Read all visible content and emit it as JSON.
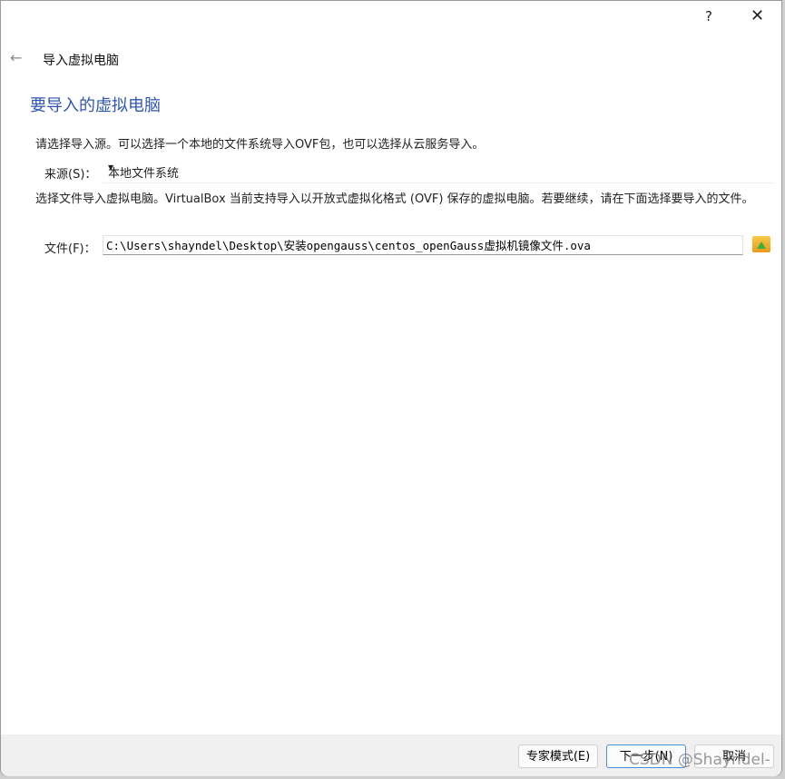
{
  "titlebar": {
    "help": "?",
    "close": "✕"
  },
  "header": {
    "back": "←",
    "title": "导入虚拟电脑"
  },
  "page": {
    "heading": "要导入的虚拟电脑",
    "intro": "请选择导入源。可以选择一个本地的文件系统导入OVF包，也可以选择从云服务导入。",
    "source_label": "来源(S)：",
    "source_value": "本地文件系统",
    "desc": "选择文件导入虚拟电脑。VirtualBox 当前支持导入以开放式虚拟化格式 (OVF) 保存的虚拟电脑。若要继续，请在下面选择要导入的文件。",
    "file_label": "文件(F)：",
    "file_value": "C:\\Users\\shayndel\\Desktop\\安装opengauss\\centos_openGauss虚拟机镜像文件.ova"
  },
  "buttons": {
    "expert": "专家模式(E)",
    "next": "下一步(N)",
    "cancel": "取消"
  },
  "watermark": "CSDN @Shayndel-"
}
